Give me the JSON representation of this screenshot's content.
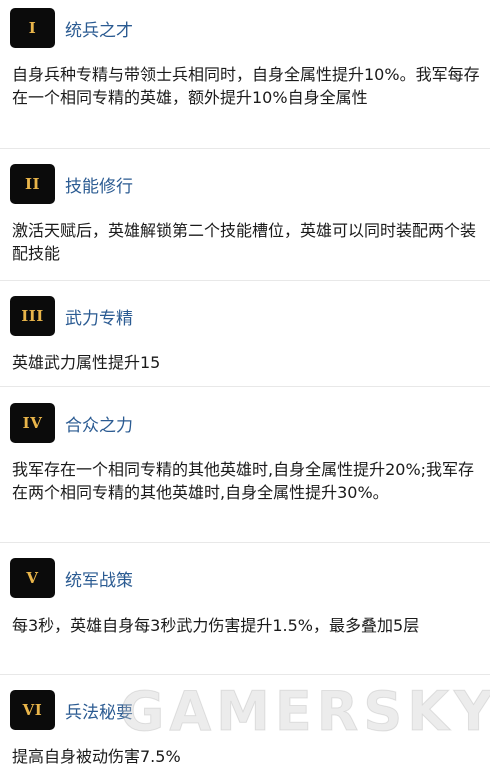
{
  "entries": [
    {
      "numeral": "I",
      "title": "统兵之才",
      "desc": "自身兵种专精与带领士兵相同时，自身全属性提升10%。我军每存在一个相同专精的英雄，额外提升10%自身全属性"
    },
    {
      "numeral": "II",
      "title": "技能修行",
      "desc": "激活天赋后，英雄解锁第二个技能槽位，英雄可以同时装配两个装配技能"
    },
    {
      "numeral": "III",
      "title": "武力专精",
      "desc": "英雄武力属性提升15"
    },
    {
      "numeral": "IV",
      "title": "合众之力",
      "desc": "我军存在一个相同专精的其他英雄时,自身全属性提升20%;我军存在两个相同专精的其他英雄时,自身全属性提升30%。"
    },
    {
      "numeral": "V",
      "title": "统军战策",
      "desc": "每3秒，英雄自身每3秒武力伤害提升1.5%，最多叠加5层"
    },
    {
      "numeral": "VI",
      "title": "兵法秘要",
      "desc": "提高自身被动伤害7.5%"
    }
  ],
  "watermark": "GAMERSKY"
}
